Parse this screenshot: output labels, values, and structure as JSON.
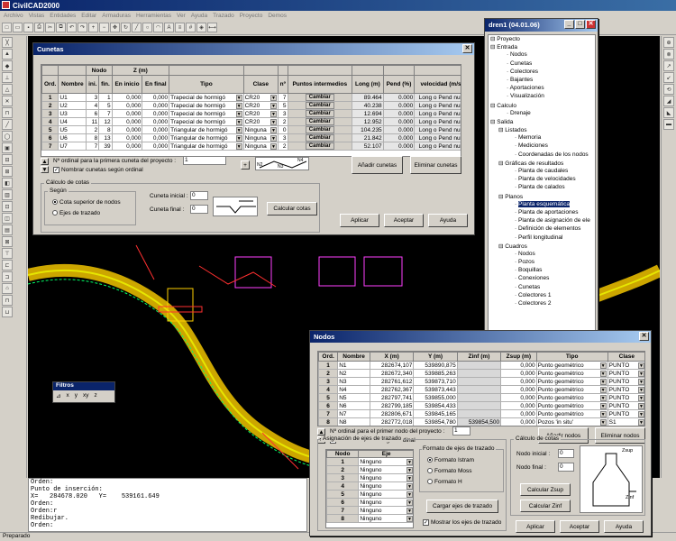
{
  "app": {
    "title": "CivilCAD2000"
  },
  "menu": [
    "Archivo",
    "Vistas",
    "Entidades",
    "Editar",
    "Armaduras",
    "Herramientas",
    "Ver",
    "Ayuda",
    "Trazado",
    "Proyecto",
    "Demos"
  ],
  "cunetas": {
    "title": "Cunetas",
    "head_nodo": "Nodo",
    "head_z": "Z (m)",
    "cols": [
      "Ord.",
      "Nombre",
      "ini.",
      "fin.",
      "En inicio",
      "En final",
      "Tipo",
      "Clase",
      "nº",
      "Puntos intermedios",
      "Long (m)",
      "Pend (%)",
      "velocidad (m/s)"
    ],
    "rows": [
      [
        "1",
        "U1",
        "3",
        "1",
        "0,000",
        "0,000",
        "Trapecial de hormigó",
        "CR20",
        "7",
        "Cambiar",
        "89.464",
        "0.000",
        "Long o Pend nula"
      ],
      [
        "2",
        "U2",
        "4",
        "5",
        "0,000",
        "0,000",
        "Trapecial de hormigó",
        "CR20",
        "5",
        "Cambiar",
        "40.238",
        "0.000",
        "Long o Pend nula"
      ],
      [
        "3",
        "U3",
        "6",
        "7",
        "0,000",
        "0,000",
        "Trapecial de hormigó",
        "CR20",
        "3",
        "Cambiar",
        "12.694",
        "0.000",
        "Long o Pend nula"
      ],
      [
        "4",
        "U4",
        "11",
        "12",
        "0,000",
        "0,000",
        "Trapecial de hormigó",
        "CR20",
        "2",
        "Cambiar",
        "12.952",
        "0.000",
        "Long o Pend nula"
      ],
      [
        "5",
        "U5",
        "2",
        "8",
        "0,000",
        "0,000",
        "Triangular de hormigó",
        "Ninguna",
        "0",
        "Cambiar",
        "104.235",
        "0.000",
        "Long o Pend nula"
      ],
      [
        "6",
        "U6",
        "8",
        "13",
        "0,000",
        "0,000",
        "Triangular de hormigó",
        "Ninguna",
        "3",
        "Cambiar",
        "21.842",
        "0.000",
        "Long o Pend nula"
      ],
      [
        "7",
        "U7",
        "7",
        "39",
        "0,000",
        "0,000",
        "Triangular de hormigó",
        "Ninguna",
        "2",
        "Cambiar",
        "52.107",
        "0.000",
        "Long o Pend nula"
      ]
    ],
    "first_label": "Nº ordinal para la primera cuneta del proyecto :",
    "first_value": "1",
    "name_by_order": "Nombrar cunetas según ordinal",
    "add": "Añadir cunetas",
    "remove": "Eliminar cunetas",
    "calc_title": "Cálculo de cotas",
    "segun": "Según",
    "opt1": "Cota superior de nodos",
    "opt2": "Ejes de trazado",
    "ini_label": "Cuneta inicial :",
    "ini_value": "0",
    "fin_label": "Cuneta final :",
    "fin_value": "0",
    "calc_btn": "Calcular cotas",
    "apply": "Aplicar",
    "accept": "Aceptar",
    "help": "Ayuda",
    "legend_n2": "N2",
    "legend_n3": "N3",
    "legend_n4": "N4"
  },
  "dren": {
    "title": "dren1 (04.01.06)",
    "tree": [
      {
        "t": "Proyecto",
        "l": 0,
        "e": "-"
      },
      {
        "t": "Entrada",
        "l": 0,
        "e": "-"
      },
      {
        "t": "Nodos",
        "l": 2
      },
      {
        "t": "Cunetas",
        "l": 2
      },
      {
        "t": "Colectores",
        "l": 2
      },
      {
        "t": "Bajantes",
        "l": 2
      },
      {
        "t": "Aportaciones",
        "l": 2
      },
      {
        "t": "Visualización",
        "l": 2
      },
      {
        "t": "Calculo",
        "l": 0,
        "e": "-"
      },
      {
        "t": "Drenaje",
        "l": 2
      },
      {
        "t": "Salida",
        "l": 0,
        "e": "-"
      },
      {
        "t": "Listados",
        "l": 1,
        "e": "-"
      },
      {
        "t": "Memoria",
        "l": 3
      },
      {
        "t": "Mediciones",
        "l": 3
      },
      {
        "t": "Coordenadas de los nodos",
        "l": 3
      },
      {
        "t": "Gráficas de resultados",
        "l": 1,
        "e": "-"
      },
      {
        "t": "Planta de caudales",
        "l": 3
      },
      {
        "t": "Planta de velocidades",
        "l": 3
      },
      {
        "t": "Planta de calados",
        "l": 3
      },
      {
        "t": "Planos",
        "l": 1,
        "e": "-"
      },
      {
        "t": "Planta esquemática",
        "l": 3,
        "sel": true
      },
      {
        "t": "Planta de aportaciones",
        "l": 3
      },
      {
        "t": "Planta de asignación de ele",
        "l": 3
      },
      {
        "t": "Definición de elementos",
        "l": 3
      },
      {
        "t": "Perfil longitudinal",
        "l": 3
      },
      {
        "t": "Cuadros",
        "l": 1,
        "e": "-"
      },
      {
        "t": "Nodos",
        "l": 3
      },
      {
        "t": "Pozos",
        "l": 3
      },
      {
        "t": "Boquillas",
        "l": 3
      },
      {
        "t": "Conexiones",
        "l": 3
      },
      {
        "t": "Cunetas",
        "l": 3
      },
      {
        "t": "Colectores 1",
        "l": 3
      },
      {
        "t": "Colectores 2",
        "l": 3
      }
    ]
  },
  "nodos": {
    "title": "Nodos",
    "cols": [
      "Ord.",
      "Nombre",
      "X (m)",
      "Y (m)",
      "Zinf (m)",
      "Zsup (m)",
      "Tipo",
      "Clase"
    ],
    "rows": [
      [
        "1",
        "N1",
        "282674,107",
        "539890,875",
        "",
        "0,000",
        "Punto geométrico",
        "PUNTO"
      ],
      [
        "2",
        "N2",
        "282672,340",
        "539885,263",
        "",
        "0,000",
        "Punto geométrico",
        "PUNTO"
      ],
      [
        "3",
        "N3",
        "282761,612",
        "539873,710",
        "",
        "0,000",
        "Punto geométrico",
        "PUNTO"
      ],
      [
        "4",
        "N4",
        "282762,367",
        "539873,443",
        "",
        "0,000",
        "Punto geométrico",
        "PUNTO"
      ],
      [
        "5",
        "N5",
        "282797,741",
        "539855,000",
        "",
        "0,000",
        "Punto geométrico",
        "PUNTO"
      ],
      [
        "6",
        "N6",
        "282799,185",
        "539854,433",
        "",
        "0,000",
        "Punto geométrico",
        "PUNTO"
      ],
      [
        "7",
        "N7",
        "282806,671",
        "539845,165",
        "",
        "0,000",
        "Punto geométrico",
        "PUNTO"
      ],
      [
        "8",
        "N8",
        "282772,018",
        "539854,780",
        "539854,500",
        "0,000",
        "Pozos 'in situ'",
        "S1"
      ]
    ],
    "first_label": "Nº ordinal para el primer nodo del proyecto :",
    "first_value": "1",
    "name_by_order": "Nombrar nodos según ordinal",
    "add": "Añadir nodos",
    "remove": "Eliminar nodos",
    "axes_title": "Asignación de ejes de trazado",
    "axes_cols": [
      "Nodo",
      "Eje"
    ],
    "axes_rows": [
      [
        "1",
        "Ninguno"
      ],
      [
        "2",
        "Ninguno"
      ],
      [
        "3",
        "Ninguno"
      ],
      [
        "4",
        "Ninguno"
      ],
      [
        "5",
        "Ninguno"
      ],
      [
        "6",
        "Ninguno"
      ],
      [
        "7",
        "Ninguno"
      ],
      [
        "8",
        "Ninguno"
      ]
    ],
    "format_title": "Formato de ejes de trazado",
    "f1": "Formato Istram",
    "f2": "Formato Moss",
    "f3": "Formato H",
    "load_axes": "Cargar ejes de trazado",
    "show_axes": "Mostrar los ejes de trazado",
    "calc_title": "Cálculo de cotas",
    "ini_label": "Nodo inicial :",
    "ini_value": "0",
    "fin_label": "Nodo final :",
    "fin_value": "0",
    "zsup": "Calcular Zsup",
    "zinf": "Calcular Zinf",
    "zsup_lbl": "Zsup",
    "zinf_lbl": "Zinf",
    "apply": "Aplicar",
    "accept": "Aceptar",
    "help": "Ayuda"
  },
  "filtros": {
    "title": "Filtros",
    "items": [
      "x",
      "y",
      "xy",
      "z"
    ]
  },
  "command": {
    "lines": [
      "Orden:",
      "Punto de inserción:",
      "X=   284678.020   Y=    539161.649",
      "Orden:",
      "Orden:r",
      "Redibujar.",
      "",
      "Orden:"
    ]
  },
  "status": "Preparado"
}
